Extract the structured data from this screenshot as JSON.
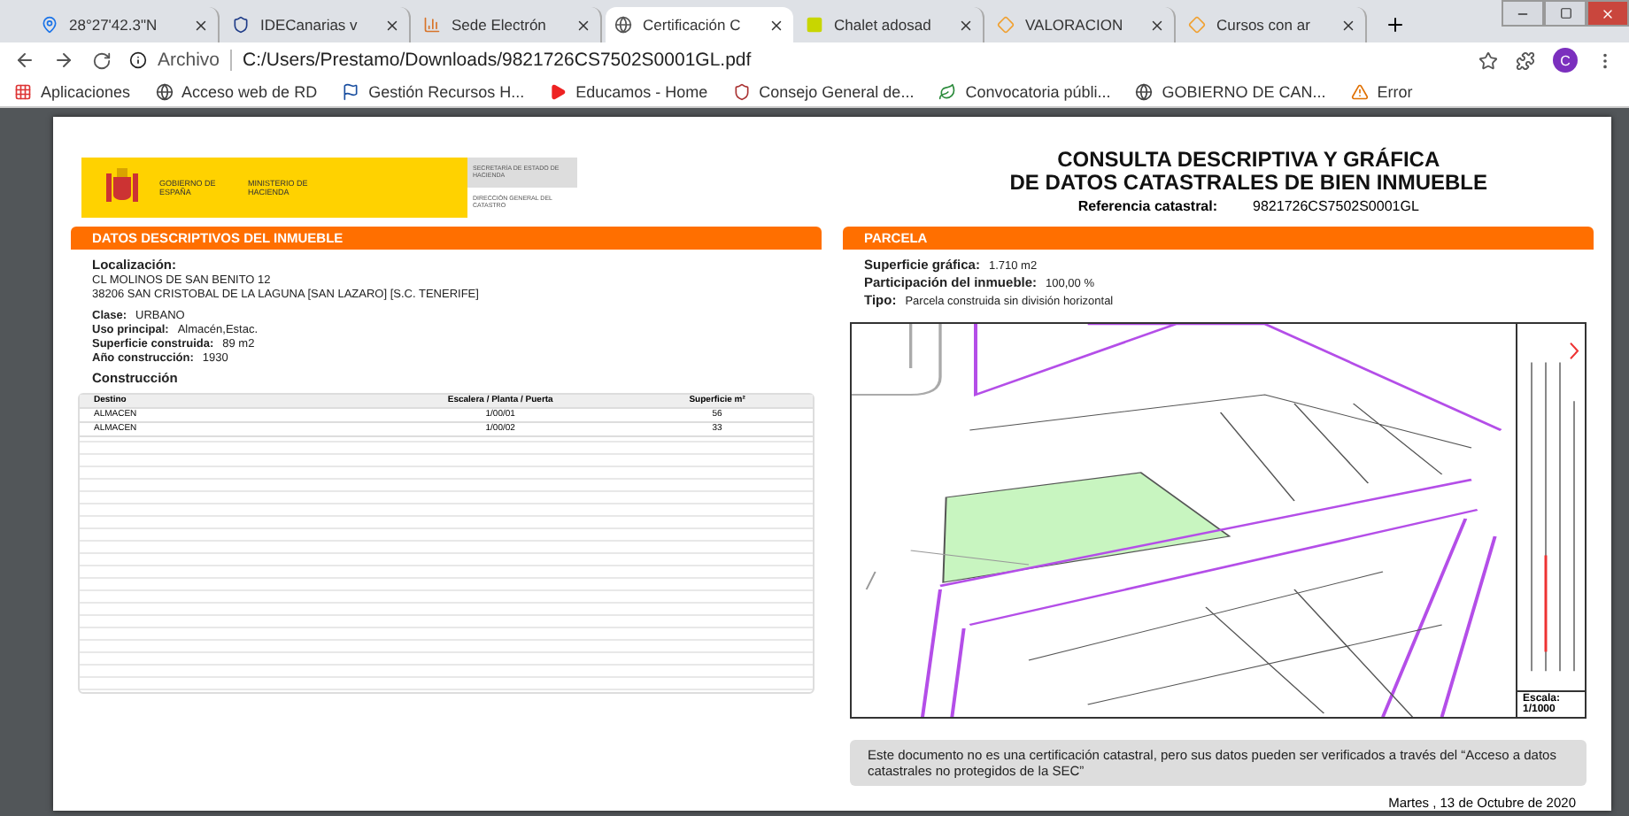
{
  "browser": {
    "tabs": [
      {
        "label": "28°27'42.3\"N",
        "selected": false,
        "kind": "map"
      },
      {
        "label": "IDECanarias v",
        "selected": false,
        "kind": "shield"
      },
      {
        "label": "Sede Electrón",
        "selected": false,
        "kind": "chart"
      },
      {
        "label": "Certificación C",
        "selected": true,
        "kind": "globe"
      },
      {
        "label": "Chalet adosad",
        "selected": false,
        "kind": "id"
      },
      {
        "label": "VALORACION",
        "selected": false,
        "kind": "diamond"
      },
      {
        "label": "Cursos con ar",
        "selected": false,
        "kind": "diamond"
      }
    ],
    "address": {
      "scheme": "Archivo",
      "url": "C:/Users/Prestamo/Downloads/9821726CS7502S0001GL.pdf"
    },
    "avatar": "C",
    "bookmarks": [
      {
        "label": "Aplicaciones",
        "kind": "apps"
      },
      {
        "label": "Acceso web de RD",
        "kind": "globe"
      },
      {
        "label": "Gestión Recursos H...",
        "kind": "flag"
      },
      {
        "label": "Educamos - Home",
        "kind": "play"
      },
      {
        "label": "Consejo General de...",
        "kind": "crest"
      },
      {
        "label": "Convocatoria públi...",
        "kind": "leaf"
      },
      {
        "label": "GOBIERNO DE CAN...",
        "kind": "globe"
      },
      {
        "label": "Error",
        "kind": "error"
      }
    ]
  },
  "document": {
    "logo": {
      "government": "GOBIERNO DE ESPAÑA",
      "ministry": "MINISTERIO DE HACIENDA",
      "secretariat": "SECRETARÍA DE ESTADO DE HACIENDA",
      "directorate": "DIRECCIÓN GENERAL DEL CATASTRO"
    },
    "title": [
      "CONSULTA DESCRIPTIVA Y GRÁFICA",
      "DE DATOS CATASTRALES DE BIEN INMUEBLE"
    ],
    "reference": {
      "label": "Referencia catastral:",
      "value": "9821726CS7502S0001GL"
    },
    "property": {
      "heading": "DATOS DESCRIPTIVOS DEL INMUEBLE",
      "location_label": "Localización:",
      "address": [
        "CL MOLINOS DE SAN BENITO 12",
        "38206 SAN CRISTOBAL DE LA LAGUNA [SAN LAZARO] [S.C. TENERIFE]"
      ],
      "fields": [
        {
          "label": "Clase:",
          "value": "URBANO"
        },
        {
          "label": "Uso principal:",
          "value": "Almacén,Estac."
        },
        {
          "label": "Superficie construida:",
          "value": "89 m2"
        },
        {
          "label": "Año construcción:",
          "value": "1930"
        }
      ],
      "construction": {
        "heading": "Construcción",
        "columns": [
          "Destino",
          "Escalera / Planta / Puerta",
          "Superficie m²"
        ],
        "rows": [
          [
            "ALMACEN",
            "1/00/01",
            "56"
          ],
          [
            "ALMACEN",
            "1/00/02",
            "33"
          ]
        ]
      }
    },
    "parcel": {
      "heading": "PARCELA",
      "fields": [
        {
          "label": "Superficie gráfica:",
          "value": "1.710 m2"
        },
        {
          "label": "Participación del inmueble:",
          "value": "100,00 %"
        },
        {
          "label": "Tipo:",
          "value": "Parcela construida sin división horizontal"
        }
      ],
      "scale": {
        "label": "Escala:",
        "value": "1/1000"
      }
    },
    "notice": "Este documento no es una certificación catastral, pero sus datos pueden ser verificados a través del “Acceso a datos catastrales no protegidos de la SEC”",
    "date": "Martes , 13 de Octubre de 2020"
  }
}
